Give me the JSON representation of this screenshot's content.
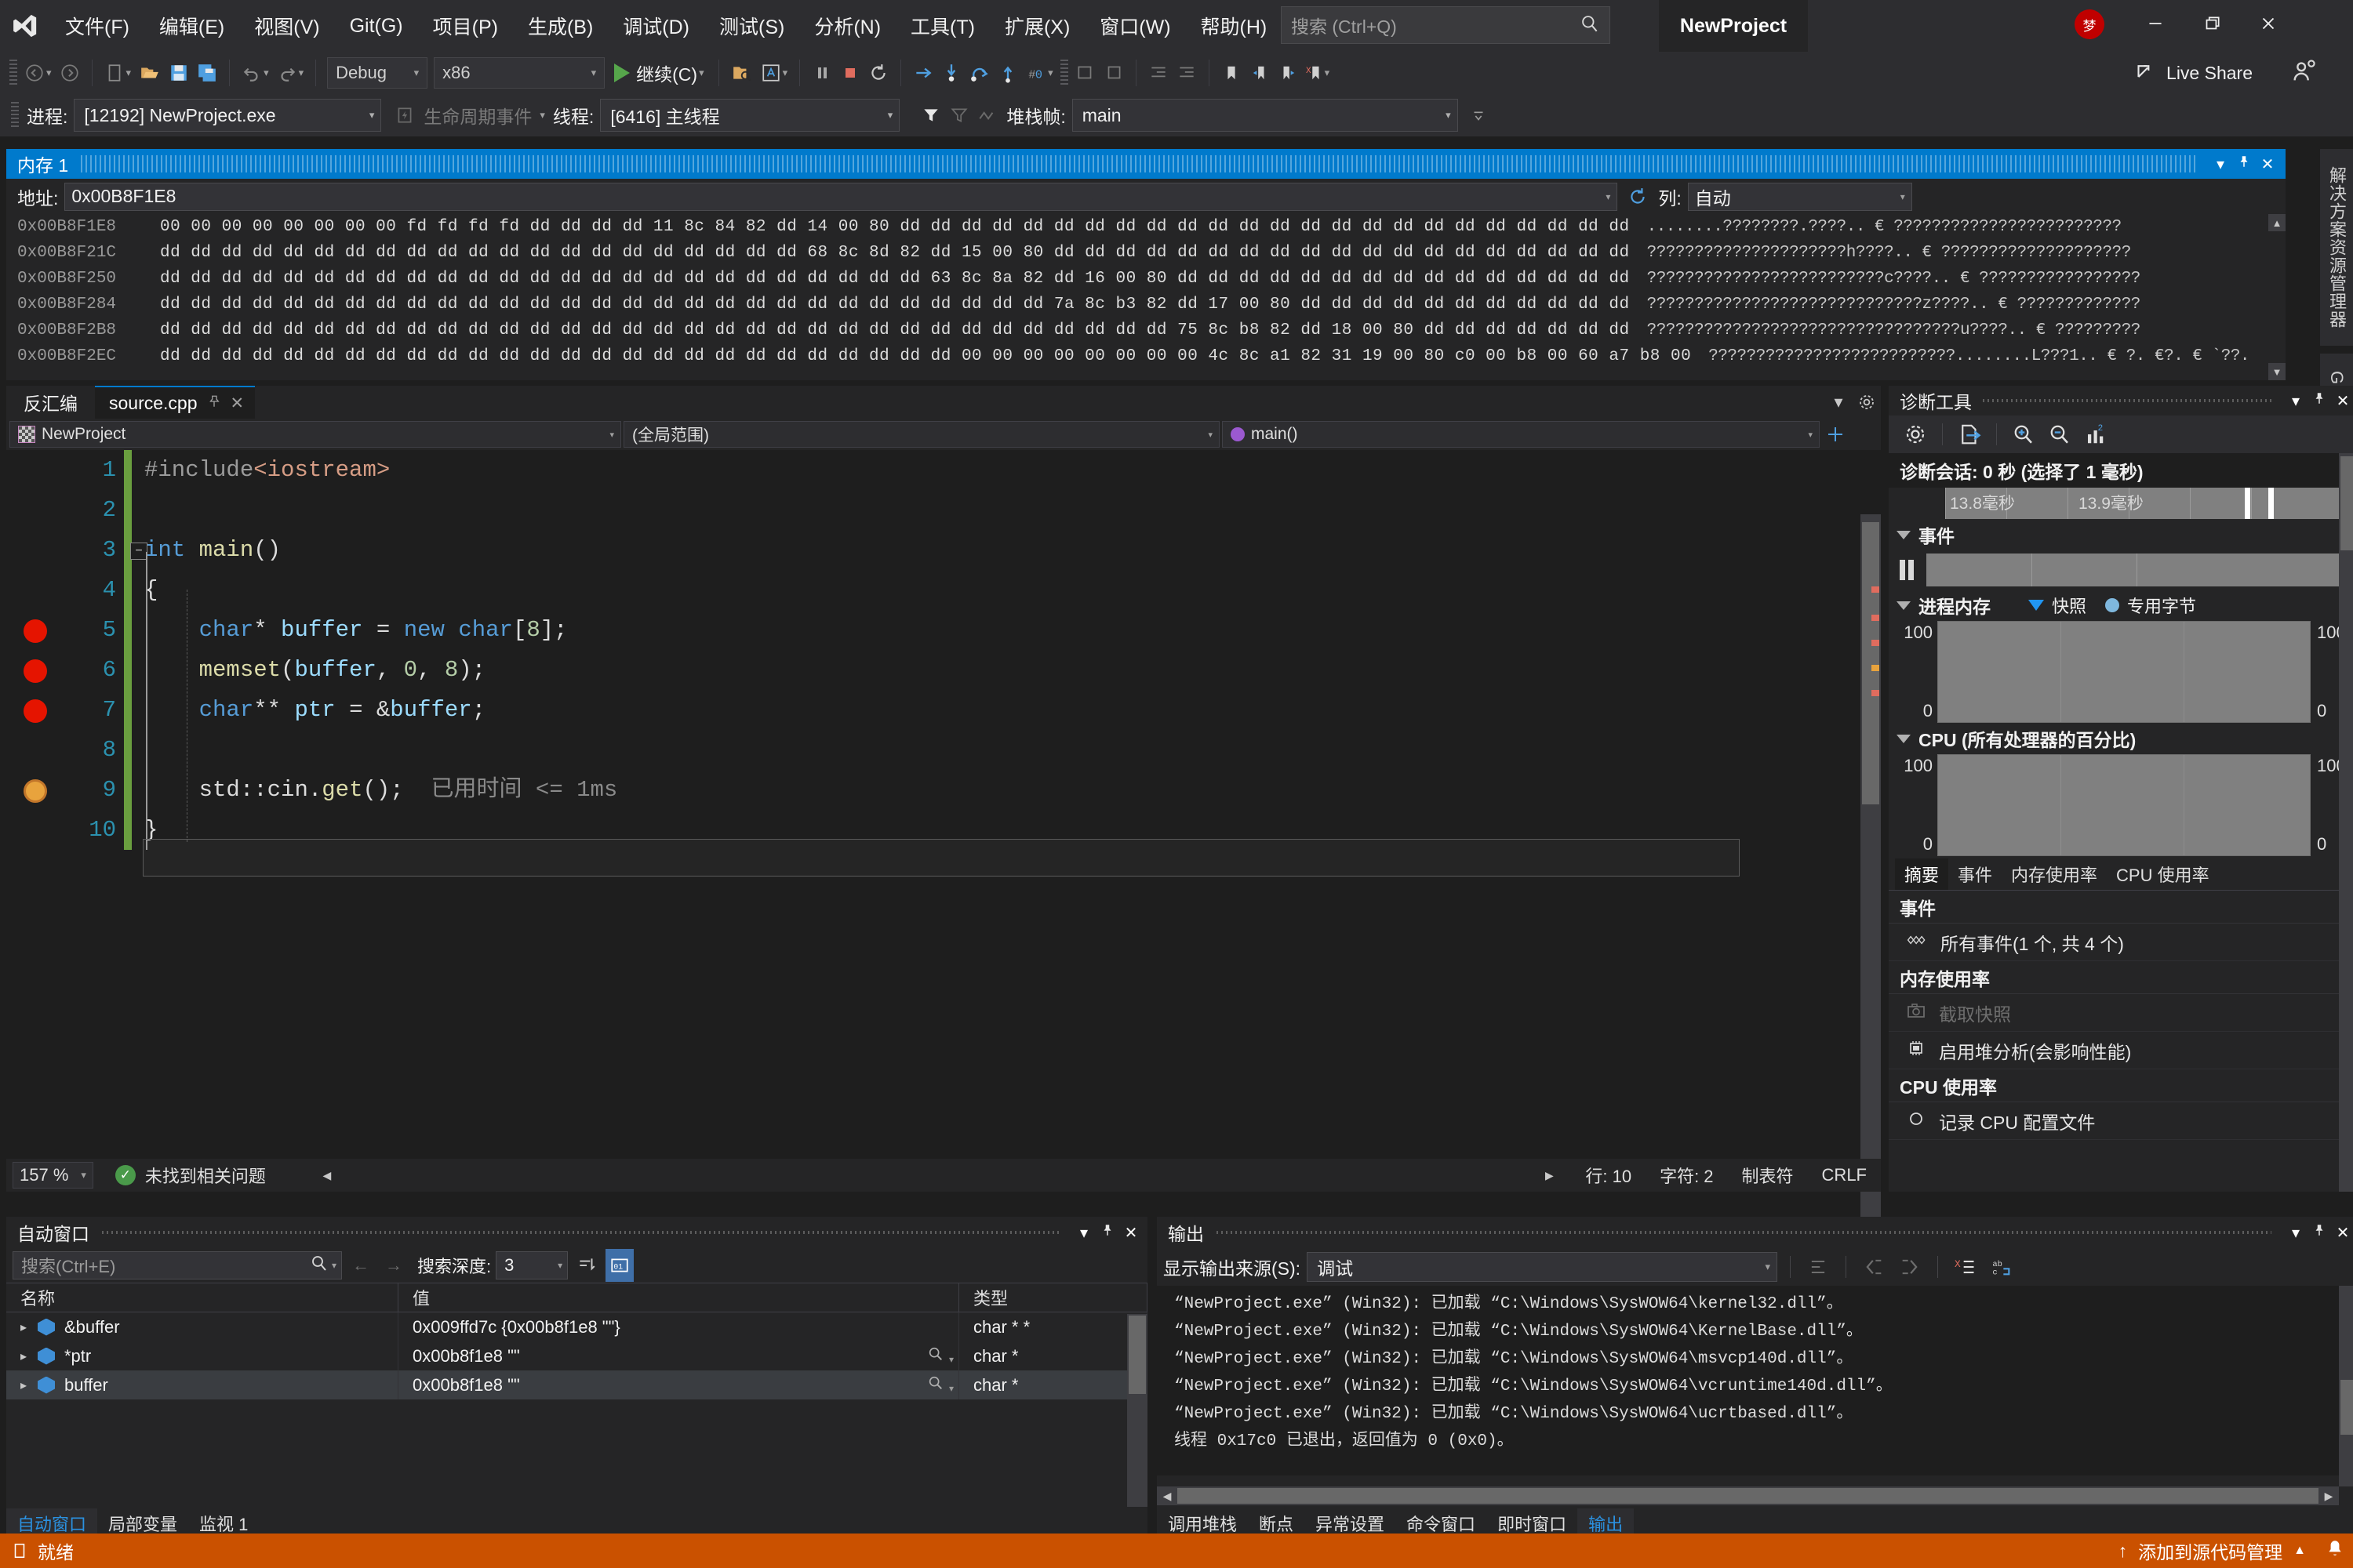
{
  "titlebar": {
    "menus": [
      "文件(F)",
      "编辑(E)",
      "视图(V)",
      "Git(G)",
      "项目(P)",
      "生成(B)",
      "调试(D)",
      "测试(S)",
      "分析(N)",
      "工具(T)",
      "扩展(X)",
      "窗口(W)",
      "帮助(H)"
    ],
    "search_placeholder": "搜索 (Ctrl+Q)",
    "project_title": "NewProject",
    "user_badge": "梦",
    "minimize": "—",
    "restore": "❐",
    "close": "✕"
  },
  "toolbar": {
    "config": "Debug",
    "platform": "x86",
    "run_label": "继续(C)",
    "live_share": "Live Share"
  },
  "debugbar": {
    "process_label": "进程:",
    "process_value": "[12192] NewProject.exe",
    "lifecycle_label": "生命周期事件",
    "thread_label": "线程:",
    "thread_value": "[6416] 主线程",
    "stackframe_label": "堆栈帧:",
    "stackframe_value": "main"
  },
  "memory": {
    "title": "内存 1",
    "address_label": "地址:",
    "address_value": "0x00B8F1E8",
    "column_label": "列:",
    "column_value": "自动",
    "rows": [
      {
        "addr": "0x00B8F1E8",
        "hex": "00 00 00 00 00 00 00 00 fd fd fd fd dd dd dd dd 11 8c 84 82 dd 14 00 80 dd dd dd dd dd dd dd dd dd dd dd dd dd dd dd dd dd dd dd dd dd dd dd dd",
        "ascii": "........????????.????.. € ????????????????????????"
      },
      {
        "addr": "0x00B8F21C",
        "hex": "dd dd dd dd dd dd dd dd dd dd dd dd dd dd dd dd dd dd dd dd dd 68 8c 8d 82 dd 15 00 80 dd dd dd dd dd dd dd dd dd dd dd dd dd dd dd dd dd dd dd",
        "ascii": "?????????????????????h????.. € ????????????????????"
      },
      {
        "addr": "0x00B8F250",
        "hex": "dd dd dd dd dd dd dd dd dd dd dd dd dd dd dd dd dd dd dd dd dd dd dd dd dd 63 8c 8a 82 dd 16 00 80 dd dd dd dd dd dd dd dd dd dd dd dd dd dd dd",
        "ascii": "?????????????????????????c????.. € ?????????????????"
      },
      {
        "addr": "0x00B8F284",
        "hex": "dd dd dd dd dd dd dd dd dd dd dd dd dd dd dd dd dd dd dd dd dd dd dd dd dd dd dd dd dd 7a 8c b3 82 dd 17 00 80 dd dd dd dd dd dd dd dd dd dd dd",
        "ascii": "?????????????????????????????z????.. € ?????????????"
      },
      {
        "addr": "0x00B8F2B8",
        "hex": "dd dd dd dd dd dd dd dd dd dd dd dd dd dd dd dd dd dd dd dd dd dd dd dd dd dd dd dd dd dd dd dd dd 75 8c b8 82 dd 18 00 80 dd dd dd dd dd dd dd",
        "ascii": "?????????????????????????????????u????.. € ?????????"
      },
      {
        "addr": "0x00B8F2EC",
        "hex": "dd dd dd dd dd dd dd dd dd dd dd dd dd dd dd dd dd dd dd dd dd dd dd dd dd dd 00 00 00 00 00 00 00 00 4c 8c a1 82 31 19 00 80 c0 00 b8 00 60 a7 b8 00",
        "ascii": "??????????????????????????........L???1.. € ?. €?. € `??."
      }
    ]
  },
  "vtabs": [
    "解决方案资源管理器",
    "Git 更改"
  ],
  "editor": {
    "tab_disasm": "反汇编",
    "tab_active": "source.cpp",
    "pin": "⌐",
    "close": "✕",
    "nav_project": "NewProject",
    "nav_scope": "(全局范围)",
    "nav_member": "main()",
    "lines": [
      {
        "no": "1",
        "tokens": [
          {
            "t": "#include",
            "c": "k-pre"
          },
          {
            "t": "<iostream>",
            "c": "k-str"
          }
        ]
      },
      {
        "no": "2",
        "tokens": []
      },
      {
        "no": "3",
        "tokens": [
          {
            "t": "int ",
            "c": "k-kw"
          },
          {
            "t": "main",
            "c": "k-fn"
          },
          {
            "t": "()",
            "c": "k-pl"
          }
        ]
      },
      {
        "no": "4",
        "tokens": [
          {
            "t": "{",
            "c": "k-pl"
          }
        ]
      },
      {
        "no": "5",
        "tokens": [
          {
            "t": "    char",
            "c": "k-kw"
          },
          {
            "t": "* ",
            "c": "k-pl"
          },
          {
            "t": "buffer",
            "c": "k-id"
          },
          {
            "t": " = ",
            "c": "k-pl"
          },
          {
            "t": "new ",
            "c": "k-kw"
          },
          {
            "t": "char",
            "c": "k-kw"
          },
          {
            "t": "[",
            "c": "k-pl"
          },
          {
            "t": "8",
            "c": "k-num"
          },
          {
            "t": "];",
            "c": "k-pl"
          }
        ]
      },
      {
        "no": "6",
        "tokens": [
          {
            "t": "    memset",
            "c": "k-fn"
          },
          {
            "t": "(",
            "c": "k-pl"
          },
          {
            "t": "buffer",
            "c": "k-id"
          },
          {
            "t": ", ",
            "c": "k-pl"
          },
          {
            "t": "0",
            "c": "k-num"
          },
          {
            "t": ", ",
            "c": "k-pl"
          },
          {
            "t": "8",
            "c": "k-num"
          },
          {
            "t": ");",
            "c": "k-pl"
          }
        ]
      },
      {
        "no": "7",
        "tokens": [
          {
            "t": "    char",
            "c": "k-kw"
          },
          {
            "t": "** ",
            "c": "k-pl"
          },
          {
            "t": "ptr",
            "c": "k-id"
          },
          {
            "t": " = &",
            "c": "k-pl"
          },
          {
            "t": "buffer",
            "c": "k-id"
          },
          {
            "t": ";",
            "c": "k-pl"
          }
        ]
      },
      {
        "no": "8",
        "tokens": []
      },
      {
        "no": "9",
        "tokens": [
          {
            "t": "    std",
            "c": "k-pl"
          },
          {
            "t": "::",
            "c": "k-pl"
          },
          {
            "t": "cin",
            "c": "k-pl"
          },
          {
            "t": ".",
            "c": "k-pl"
          },
          {
            "t": "get",
            "c": "k-fn"
          },
          {
            "t": "();",
            "c": "k-pl"
          },
          {
            "t": "  已用时间 <= 1ms",
            "c": "k-hint"
          }
        ]
      },
      {
        "no": "10",
        "tokens": [
          {
            "t": "}",
            "c": "k-pl"
          }
        ]
      }
    ],
    "zoom": "157 %",
    "issue_status": "未找到相关问题",
    "line_label": "行: 10",
    "char_label": "字符: 2",
    "tab_mode": "制表符",
    "eol": "CRLF"
  },
  "diagnostics": {
    "title": "诊断工具",
    "toolbar_icons": [
      "gear-icon",
      "export-icon",
      "zoom-in-icon",
      "zoom-out-icon",
      "chart-icon"
    ],
    "session_text": "诊断会话: 0 秒 (选择了 1 毫秒)",
    "timeline_ticks": [
      "13.8毫秒",
      "13.9毫秒"
    ],
    "events_section": "事件",
    "memory_section": "进程内存",
    "legend_snapshot": "快照",
    "legend_private": "专用字节",
    "mem_axis_top": "100",
    "mem_axis_bottom": "0",
    "cpu_section": "CPU (所有处理器的百分比)",
    "cpu_axis_top": "100",
    "cpu_axis_bottom": "0",
    "tabs": [
      "摘要",
      "事件",
      "内存使用率",
      "CPU 使用率"
    ],
    "active_tab": "摘要",
    "summary": [
      {
        "type": "header",
        "label": "事件"
      },
      {
        "type": "item",
        "icon": "events-icon",
        "label": "所有事件(1 个, 共 4 个)",
        "disabled": false
      },
      {
        "type": "header",
        "label": "内存使用率"
      },
      {
        "type": "item",
        "icon": "camera-icon",
        "label": "截取快照",
        "disabled": true
      },
      {
        "type": "item",
        "icon": "heap-icon",
        "label": "启用堆分析(会影响性能)",
        "disabled": false
      },
      {
        "type": "header",
        "label": "CPU 使用率"
      },
      {
        "type": "item",
        "icon": "record-icon",
        "label": "记录 CPU 配置文件",
        "disabled": false
      }
    ]
  },
  "autos": {
    "title": "自动窗口",
    "search_placeholder": "搜索(Ctrl+E)",
    "depth_label": "搜索深度:",
    "depth_value": "3",
    "columns": [
      "名称",
      "值",
      "类型"
    ],
    "rows": [
      {
        "name": "&buffer",
        "value": "0x009ffd7c {0x00b8f1e8 \"\"}",
        "type": "char * *",
        "magnifier": false,
        "selected": false
      },
      {
        "name": "*ptr",
        "value": "0x00b8f1e8 \"\"",
        "type": "char *",
        "magnifier": true,
        "selected": false
      },
      {
        "name": "buffer",
        "value": "0x00b8f1e8 \"\"",
        "type": "char *",
        "magnifier": true,
        "selected": true
      }
    ],
    "tabs": [
      "自动窗口",
      "局部变量",
      "监视 1"
    ],
    "active_tab": "自动窗口"
  },
  "output": {
    "title": "输出",
    "source_label": "显示输出来源(S):",
    "source_value": "调试",
    "lines": [
      "“NewProject.exe” (Win32): 已加载 “C:\\Windows\\SysWOW64\\kernel32.dll”。",
      "“NewProject.exe” (Win32): 已加载 “C:\\Windows\\SysWOW64\\KernelBase.dll”。",
      "“NewProject.exe” (Win32): 已加载 “C:\\Windows\\SysWOW64\\msvcp140d.dll”。",
      "“NewProject.exe” (Win32): 已加载 “C:\\Windows\\SysWOW64\\vcruntime140d.dll”。",
      "“NewProject.exe” (Win32): 已加载 “C:\\Windows\\SysWOW64\\ucrtbased.dll”。",
      "线程 0x17c0 已退出，返回值为 0 (0x0)。"
    ],
    "tabs": [
      "调用堆栈",
      "断点",
      "异常设置",
      "命令窗口",
      "即时窗口",
      "输出"
    ],
    "active_tab": "输出"
  },
  "statusbar": {
    "ready": "就绪",
    "source_control": "添加到源代码管理",
    "accent": "#ca5100"
  }
}
